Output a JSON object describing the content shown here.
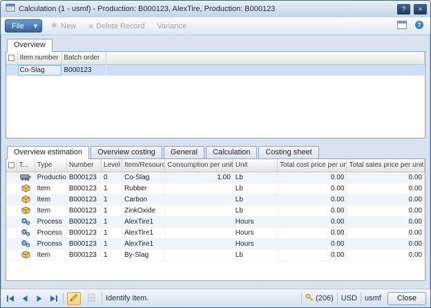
{
  "window": {
    "title": "Calculation (1 - usmf) - Production: B000123, AlexTire, Production: B000123",
    "help_glyph": "?",
    "close_glyph": "×"
  },
  "toolbar": {
    "file_label": "File",
    "new_label": "New",
    "delete_label": "Delete Record",
    "variance_label": "Variance"
  },
  "overview": {
    "tab_label": "Overview",
    "columns": {
      "item_number": "Item number",
      "batch_order": "Batch order"
    },
    "rows": [
      {
        "item_number": "Co-Slag",
        "batch_order": "B000123"
      }
    ]
  },
  "estimation": {
    "tabs": [
      "Overview estimation",
      "Overview costing",
      "General",
      "Calculation",
      "Costing sheet"
    ],
    "columns": [
      "T...",
      "Type",
      "Number",
      "Level",
      "Item/Resource",
      "Consumption per unit",
      "Unit",
      "Total cost price per unit",
      "Total sales price per unit"
    ],
    "rows": [
      {
        "icon": "production-icon",
        "type": "Production",
        "number": "B000123",
        "level": "0",
        "item_resource": "Co-Slag",
        "consumption": "1.00",
        "unit": "Lb",
        "total_cost": "0.00",
        "total_sales": "0.00"
      },
      {
        "icon": "item-icon",
        "type": "Item",
        "number": "B000123",
        "level": "1",
        "item_resource": "Rubber",
        "consumption": "",
        "unit": "Lb",
        "total_cost": "0.00",
        "total_sales": "0.00"
      },
      {
        "icon": "item-icon",
        "type": "Item",
        "number": "B000123",
        "level": "1",
        "item_resource": "Carbon",
        "consumption": "",
        "unit": "Lb",
        "total_cost": "0.00",
        "total_sales": "0.00"
      },
      {
        "icon": "item-icon",
        "type": "Item",
        "number": "B000123",
        "level": "1",
        "item_resource": "ZinkOxide",
        "consumption": "",
        "unit": "Lb",
        "total_cost": "0.00",
        "total_sales": "0.00"
      },
      {
        "icon": "process-icon",
        "type": "Process",
        "number": "B000123",
        "level": "1",
        "item_resource": "AlexTire1",
        "consumption": "",
        "unit": "Hours",
        "total_cost": "0.00",
        "total_sales": "0.00"
      },
      {
        "icon": "process-icon",
        "type": "Process",
        "number": "B000123",
        "level": "1",
        "item_resource": "AlexTire1",
        "consumption": "",
        "unit": "Hours",
        "total_cost": "0.00",
        "total_sales": "0.00"
      },
      {
        "icon": "process-icon",
        "type": "Process",
        "number": "B000123",
        "level": "1",
        "item_resource": "AlexTire1",
        "consumption": "",
        "unit": "Hours",
        "total_cost": "0.00",
        "total_sales": "0.00"
      },
      {
        "icon": "item-icon",
        "type": "Item",
        "number": "B000123",
        "level": "1",
        "item_resource": "By-Slag",
        "consumption": "",
        "unit": "Lb",
        "total_cost": "0.00",
        "total_sales": "0.00"
      }
    ]
  },
  "status_bar": {
    "message": "Identify item.",
    "alert_count": "(206)",
    "currency": "USD",
    "company": "usmf",
    "close_label": "Close"
  }
}
